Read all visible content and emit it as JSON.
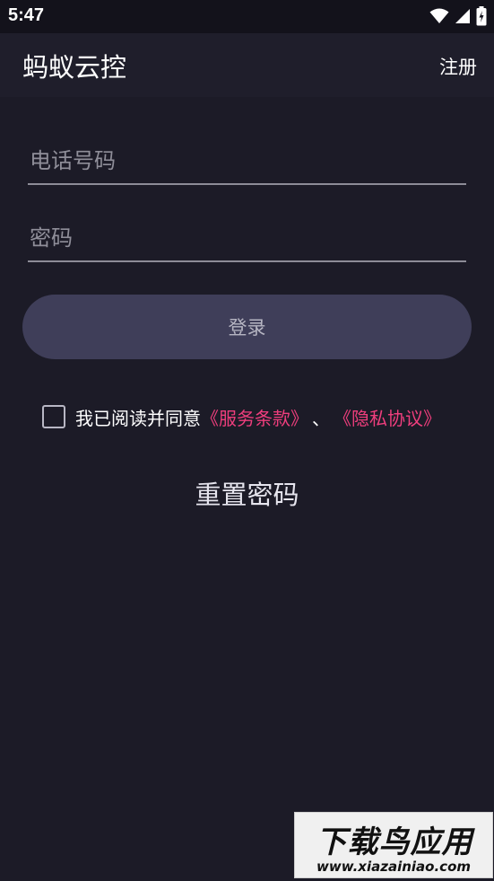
{
  "status_bar": {
    "time": "5:47",
    "icons": [
      "wifi-icon",
      "signal-icon",
      "battery-icon"
    ]
  },
  "app_bar": {
    "title": "蚂蚁云控",
    "register_label": "注册"
  },
  "form": {
    "phone_placeholder": "电话号码",
    "phone_value": "",
    "password_placeholder": "密码",
    "password_value": "",
    "login_label": "登录"
  },
  "agreement": {
    "checked": false,
    "prefix": "我已阅读并同意",
    "terms_link": "《服务条款》",
    "separator": "、",
    "privacy_link": "《隐私协议》"
  },
  "reset_password_label": "重置密码",
  "watermark": {
    "main": "下载鸟应用",
    "sub": "www.xiazainiao.com"
  },
  "colors": {
    "background": "#1c1b27",
    "app_bar": "#1f1e2b",
    "button": "#3f3e59",
    "link_accent": "#ef3e7d"
  }
}
